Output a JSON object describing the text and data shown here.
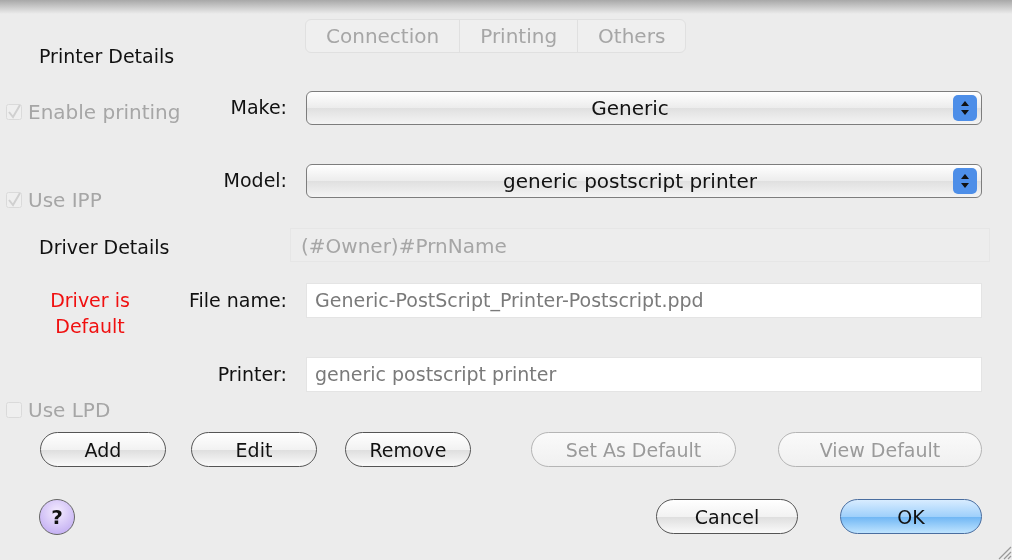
{
  "background_window": {
    "tabs": [
      {
        "label": "Connection"
      },
      {
        "label": "Printing"
      },
      {
        "label": "Others"
      }
    ],
    "options": [
      {
        "label": "Enable printing",
        "checked": true
      },
      {
        "label": "Use IPP",
        "checked": true
      },
      {
        "label": "Use LPD",
        "checked": false
      }
    ],
    "queue_name_value": "(#Owner)#PrnName"
  },
  "printer_details": {
    "title": "Printer Details",
    "fields": [
      {
        "label": "Make:",
        "value": "Generic"
      },
      {
        "label": "Model:",
        "value": "generic postscript printer"
      }
    ]
  },
  "driver_details": {
    "title": "Driver Details",
    "status": "Driver is Default",
    "fields": [
      {
        "label": "File name:",
        "value": "Generic-PostScript_Printer-Postscript.ppd"
      },
      {
        "label": "Printer:",
        "value": "generic postscript printer"
      }
    ]
  },
  "buttons": [
    {
      "label": "Add",
      "disabled": false
    },
    {
      "label": "Edit",
      "disabled": false
    },
    {
      "label": "Remove",
      "disabled": false
    },
    {
      "label": "Set As Default",
      "disabled": true
    },
    {
      "label": "View Default",
      "disabled": true
    }
  ],
  "help_button": "?",
  "footer_buttons": [
    {
      "label": "Cancel",
      "default": false
    },
    {
      "label": "OK",
      "default": true
    }
  ]
}
